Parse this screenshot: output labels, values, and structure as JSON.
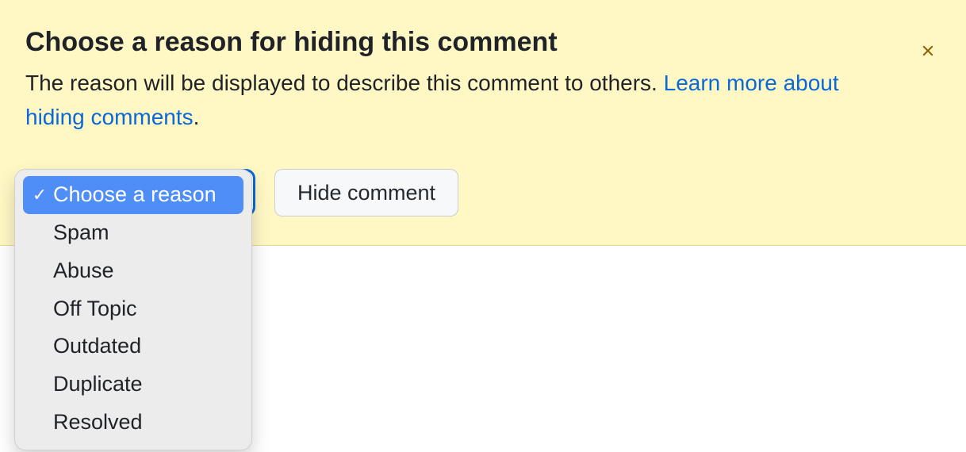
{
  "banner": {
    "title": "Choose a reason for hiding this comment",
    "description_prefix": "The reason will be displayed to describe this comment to others. ",
    "link_text": "Learn more about hiding comments",
    "description_suffix": "."
  },
  "controls": {
    "hide_button": "Hide comment"
  },
  "dropdown": {
    "selected_index": 0,
    "options": [
      "Choose a reason",
      "Spam",
      "Abuse",
      "Off Topic",
      "Outdated",
      "Duplicate",
      "Resolved"
    ]
  }
}
